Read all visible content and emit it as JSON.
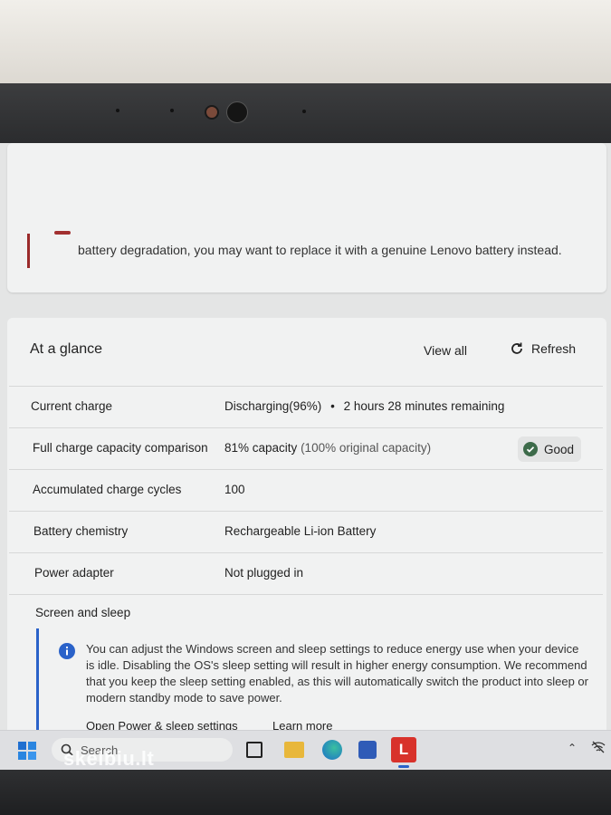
{
  "warning": {
    "text": "battery degradation, you may want to replace it with a genuine Lenovo battery instead."
  },
  "at_a_glance": {
    "title": "At a glance",
    "view_all": "View all",
    "refresh": "Refresh",
    "rows": [
      {
        "label": "Current charge",
        "value": "Discharging(96%)",
        "separator": "•",
        "extra": "2 hours 28 minutes remaining"
      },
      {
        "label": "Full charge capacity comparison",
        "value": "81% capacity",
        "extra": "(100% original capacity)",
        "status": "Good"
      },
      {
        "label": "Accumulated charge cycles",
        "value": "100"
      },
      {
        "label": "Battery chemistry",
        "value": "Rechargeable Li-ion Battery"
      },
      {
        "label": "Power adapter",
        "value": "Not plugged in"
      }
    ],
    "screen_and_sleep": {
      "title": "Screen and sleep",
      "info": "You can adjust the Windows screen and sleep settings to reduce energy use when your device is idle. Disabling the OS's sleep setting will result in higher energy consumption. We recommend that you keep the sleep setting enabled, as this will automatically switch the product into sleep or modern standby mode to save power.",
      "link_settings": "Open Power & sleep settings",
      "link_learn": "Learn more"
    }
  },
  "taskbar": {
    "search_placeholder": "Search",
    "watermark": "skelbiu.lt",
    "app_badge": "L"
  },
  "colors": {
    "accent_blue": "#2a62c9",
    "good_green": "#3d6b4a",
    "warning_red": "#9a2a2a",
    "lenovo_red": "#d8322b"
  }
}
